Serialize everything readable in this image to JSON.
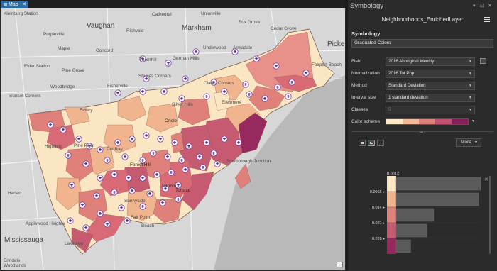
{
  "map_tab": {
    "label": "Map",
    "close": "✕"
  },
  "map": {
    "labels_major": [
      "Vaughan",
      "Markham",
      "Pickering",
      "Mississauga"
    ],
    "labels_minor": [
      "Kleinburg Station",
      "Purpleville",
      "Cathedral",
      "Richvale",
      "Box Grove",
      "Maple",
      "Cedar Grove",
      "Unionville",
      "Elder Station",
      "Pine Grove",
      "Concord",
      "Thornhill",
      "German Mills",
      "Underwood",
      "Armadale",
      "Fairport Beach",
      "Sunset Corners",
      "Woodbridge",
      "Steeles Corners",
      "Clarks Corners",
      "Fisherville",
      "Emery",
      "Highfield",
      "Pine Point",
      "Del Ray",
      "Silver Hills",
      "Ellesmere",
      "Harlan",
      "Applewood Heights",
      "Lakeview",
      "Erindale Woodlands",
      "Sunnyside",
      "Fair Point",
      "Beach",
      "Toronto",
      "Scarborough Junction"
    ],
    "labels_on_map": [
      "Oriole",
      "Forest Hill",
      "Toronto"
    ]
  },
  "symbology": {
    "pane_title": "Symbology",
    "layer_name": "Neighbourhoods_EnrichedLayer",
    "section_title": "Symbology",
    "renderer": "Graduated Colors",
    "rows": [
      {
        "label": "Field",
        "value": "2016 Aboriginal Identity"
      },
      {
        "label": "Normalization",
        "value": "2016 Tot Pop"
      },
      {
        "label": "Method",
        "value": "Standard Deviation"
      },
      {
        "label": "Interval size",
        "value": "1 standard deviation"
      },
      {
        "label": "Classes",
        "value": "5"
      },
      {
        "label": "Color scheme",
        "value": ""
      }
    ],
    "scheme_colors": [
      "#fce8c6",
      "#f3b897",
      "#e07e7c",
      "#c44f6e",
      "#8b1c5a"
    ],
    "more_label": "More",
    "histogram": {
      "top_value": "0.0013",
      "bottom_value": "0.048",
      "breaks": [
        "0.0065",
        "0.014",
        "0.021",
        "0.028"
      ],
      "bar_fractions": [
        0.99,
        0.97,
        0.44,
        0.36,
        0.17
      ],
      "class_colors": [
        "#fce8c6",
        "#f0b48e",
        "#e0807a",
        "#c65a70",
        "#962a5e"
      ]
    }
  }
}
